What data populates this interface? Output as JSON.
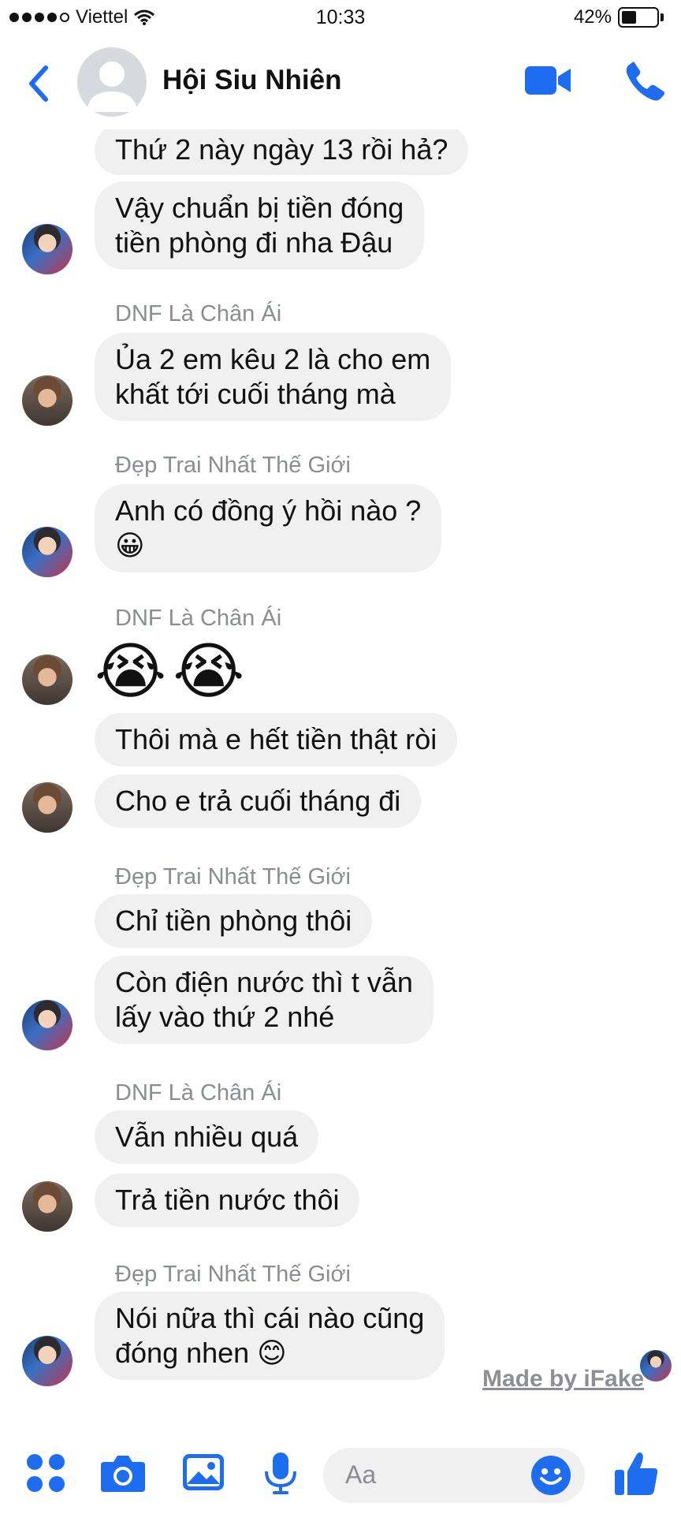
{
  "status_bar": {
    "carrier": "Viettel",
    "time": "10:33",
    "battery": "42%",
    "battery_level": 0.42
  },
  "header": {
    "title": "Hội Siu Nhiên"
  },
  "messages": {
    "m1": "Thứ 2 này ngày 13 rồi hả?",
    "m2_l1": "Vậy chuẩn bị tiền đóng",
    "m2_l2": "tiền phòng đi nha Đậu",
    "s1": "DNF Là Chân Ái",
    "m3_l1": "Ủa 2 em kêu 2 là cho em",
    "m3_l2": "khất tới cuối tháng mà",
    "s2": "Đẹp Trai Nhất Thế Giới",
    "m4_l1": "Anh có đồng ý hồi nào ?",
    "m4_l2": "😀",
    "s3": "DNF Là Chân Ái",
    "emoji_1": "😭",
    "emoji_2": "😭",
    "m5": "Thôi mà e hết tiền thật ròi",
    "m6": "Cho e trả cuối tháng đi",
    "s4": "Đẹp Trai Nhất Thế Giới",
    "m7": "Chỉ tiền phòng thôi",
    "m8_l1": "Còn điện nước thì t vẫn",
    "m8_l2": "lấy vào thứ 2 nhé",
    "s5": "DNF Là Chân Ái",
    "m9": "Vẫn nhiều quá",
    "m10": "Trả tiền nước thôi",
    "s6": "Đẹp Trai Nhất Thế Giới",
    "m11_l1": "Nói nữa thì cái nào cũng",
    "m11_l2": "đóng nhen 😊"
  },
  "watermark": "Made by iFake",
  "composer": {
    "placeholder": "Aa"
  },
  "colors": {
    "accent": "#1e6cf0",
    "bubble": "#f0f0f0",
    "sender": "#8a8d91"
  },
  "icons": [
    "back-chevron-icon",
    "video-camera-icon",
    "phone-icon",
    "apps-grid-icon",
    "camera-icon",
    "image-icon",
    "microphone-icon",
    "smile-icon",
    "thumbs-up-icon"
  ]
}
